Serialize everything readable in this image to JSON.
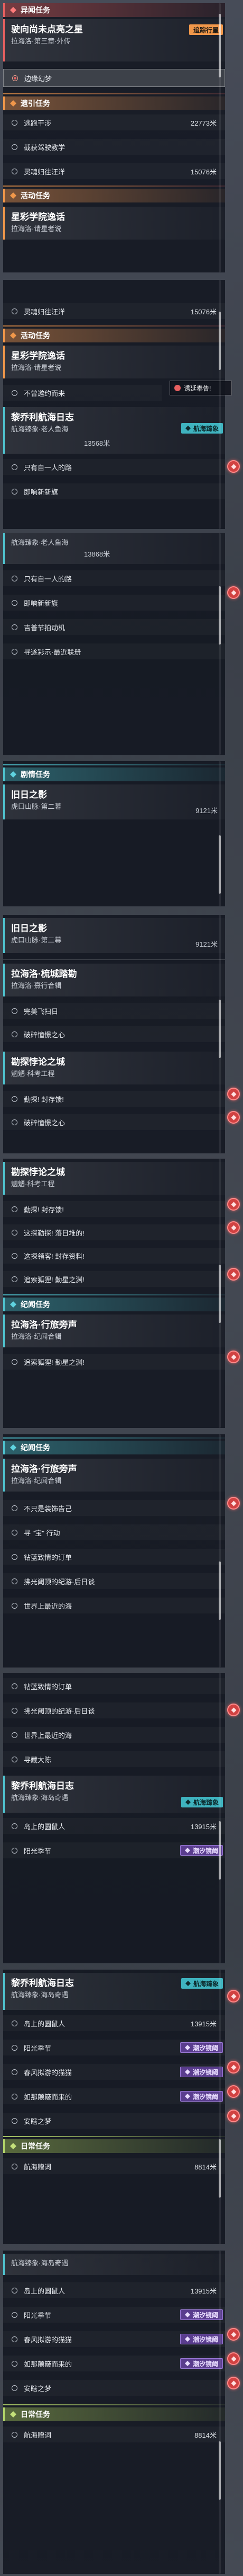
{
  "panel1": {
    "header_anomaly": "异闻任务",
    "card_title": "驶向尚未点亮之星",
    "card_subtitle": "拉海洛·第三章·外传",
    "badge_tracking": "追踪行星",
    "selected_row": "边缘幻梦",
    "header_missed": "遗引任务",
    "rows": [
      {
        "label": "逃跑干涉",
        "distance": "22773米"
      },
      {
        "label": "截获驾驶教学",
        "distance": ""
      },
      {
        "label": "灵魂归往汪洋",
        "distance": "15076米"
      }
    ],
    "header_activity": "活动任务",
    "activity_title": "星彩学院逸话",
    "activity_subtitle": "拉海洛·请星者说"
  },
  "panel2": {
    "row_top": {
      "label": "灵魂归往汪洋",
      "distance": "15076米"
    },
    "header_activity": "活动任务",
    "card_title": "星彩学院逸话",
    "card_subtitle": "拉海洛·请星者说",
    "tip": "诱延奉告!",
    "row_invite": "不曾邀约而来",
    "card2_title": "黎乔利航海日志",
    "card2_subtitle": "航海臻象·老人鱼海",
    "card2_badge": "航海臻象",
    "card2_distance": "13568米",
    "rows": [
      "只有自一人的路",
      "即响新新旗"
    ]
  },
  "panel3": {
    "top_subtitle": "航海臻象·老人鱼海",
    "top_distance": "13868米",
    "rows": [
      "只有自一人的路",
      "即响新新旗",
      "吉普节拍动机",
      "寻遂彩示·最近联册"
    ]
  },
  "panel4": {
    "header_main": "剧情任务",
    "card_title": "旧日之影",
    "card_subtitle": "虎口山脉·第二幕",
    "card_distance": "9121米"
  },
  "panel5": {
    "card_title": "旧日之影",
    "card_subtitle": "虎口山脉·第二幕",
    "card_distance": "9121米",
    "card2_title": "拉海洛·梳城踏勘",
    "card2_subtitle": "拉海洛·熹行合辑",
    "rows": [
      "完美飞扫日",
      "破碎憧憬之心"
    ],
    "card3_title": "勘探悖论之城",
    "card3_subtitle": "魍魉·科考工程",
    "rows3": [
      "勤探! 封存馈!",
      "破碎憧憬之心"
    ]
  },
  "panel6": {
    "card_title": "勘探悖论之城",
    "card_subtitle": "魍魉·科考工程",
    "rows": [
      "勤探! 封存馈!",
      "这探勤探! 落日堆的!",
      "这探领客! 封存资料!",
      "追索狐狸! 勤星之渊!"
    ],
    "header_side": "纪闻任务",
    "card2_title": "拉海洛·行旅旁声",
    "card2_subtitle": "拉海洛·纪闻合辑",
    "row_bottom": "追索狐狸! 勤星之渊!"
  },
  "panel7": {
    "header_side": "纪闻任务",
    "card_title": "拉海洛·行旅旁声",
    "card_subtitle": "拉海洛·纪闻合辑",
    "rows": [
      "不只是装饰告己",
      "寻 \"宝\" 行动",
      "钻蓝致情的订单",
      "拂光阈顶的纪游·后日谈",
      "世界上最近的海"
    ]
  },
  "panel8": {
    "rows": [
      "钻蓝致情的订单",
      "拂光阈顶的纪游·后日谈",
      "世界上最近的海",
      "寻藏大陈"
    ],
    "card_title": "黎乔利航海日志",
    "card_subtitle": "航海臻象·海岛奇遇",
    "card_badge": "航海臻象",
    "row_sea": {
      "label": "岛上的圆鼠人",
      "distance": "13915米"
    },
    "row_spring": {
      "label": "阳光季节",
      "badge": "潮汐镜阈"
    }
  },
  "panel9": {
    "card_title": "黎乔利航海日志",
    "card_subtitle": "航海臻象·海岛奇遇",
    "card_badge": "航海臻象",
    "row_sea": {
      "label": "岛上的圆鼠人",
      "distance": "13915米"
    },
    "row_spring": {
      "label": "阳光季节",
      "badge": "潮汐镜阈"
    },
    "row_wind": {
      "label": "春风拟游的猫猫",
      "badge": "潮汐镜阈"
    },
    "row_hermit": {
      "label": "如那颠簸而来的",
      "badge": "潮汐镜阈"
    },
    "row_dream": "安瞎之梦",
    "header_daily": "日常任务",
    "daily_row": {
      "label": "航海赠词",
      "distance": "8814米"
    }
  },
  "panel10": {
    "top_subtitle": "航海臻象·海岛奇遇",
    "row_sea": {
      "label": "岛上的圆鼠人",
      "distance": "13915米"
    },
    "row_spring": {
      "label": "阳光季节",
      "badge": "潮汐镜阈"
    },
    "row_wind": {
      "label": "春风拟游的猫猫",
      "badge": "潮汐镜阈"
    },
    "row_hermit": {
      "label": "如那颠簸而来的",
      "badge": "潮汐镜阈"
    },
    "row_dream": "安瞎之梦",
    "header_daily": "日常任务",
    "daily_row": {
      "label": "航海赠词",
      "distance": "8814米"
    }
  }
}
